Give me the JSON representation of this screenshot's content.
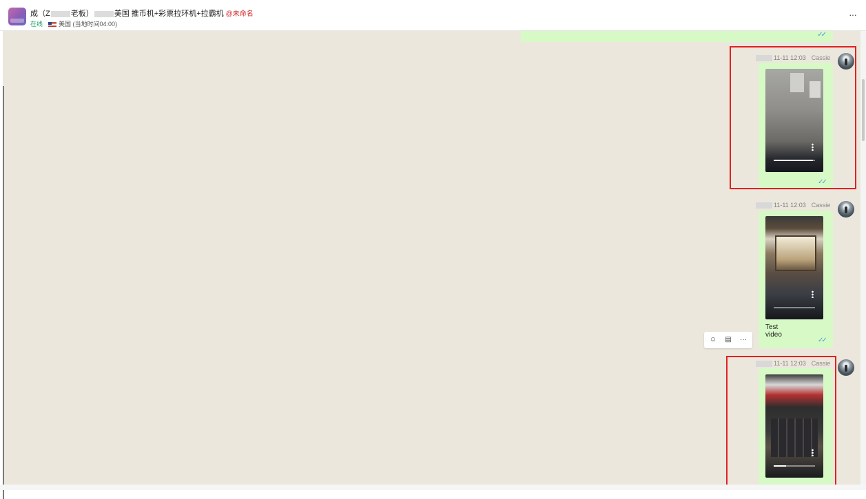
{
  "header": {
    "title_prefix": "成（Z",
    "title_mid": "老板）",
    "title_suffix": "美国 推币机+彩票拉环机+拉霸机",
    "mention": "@未命名",
    "status": "在线",
    "country": "美国",
    "local_time": "(当地时间04:00)",
    "more": "···"
  },
  "messages": [
    {
      "time": "11-11 12:03",
      "sender": "Cassie",
      "caption": "",
      "progress": 0.95
    },
    {
      "time": "11-11 12:03",
      "sender": "Cassie",
      "caption": "Test video",
      "progress": 0.0
    },
    {
      "time": "11-11 12:03",
      "sender": "Cassie",
      "caption": "",
      "progress": 0.3
    }
  ],
  "ticks": "✓✓",
  "actions": {
    "react": "☺",
    "reply": "▤",
    "more": "···"
  }
}
